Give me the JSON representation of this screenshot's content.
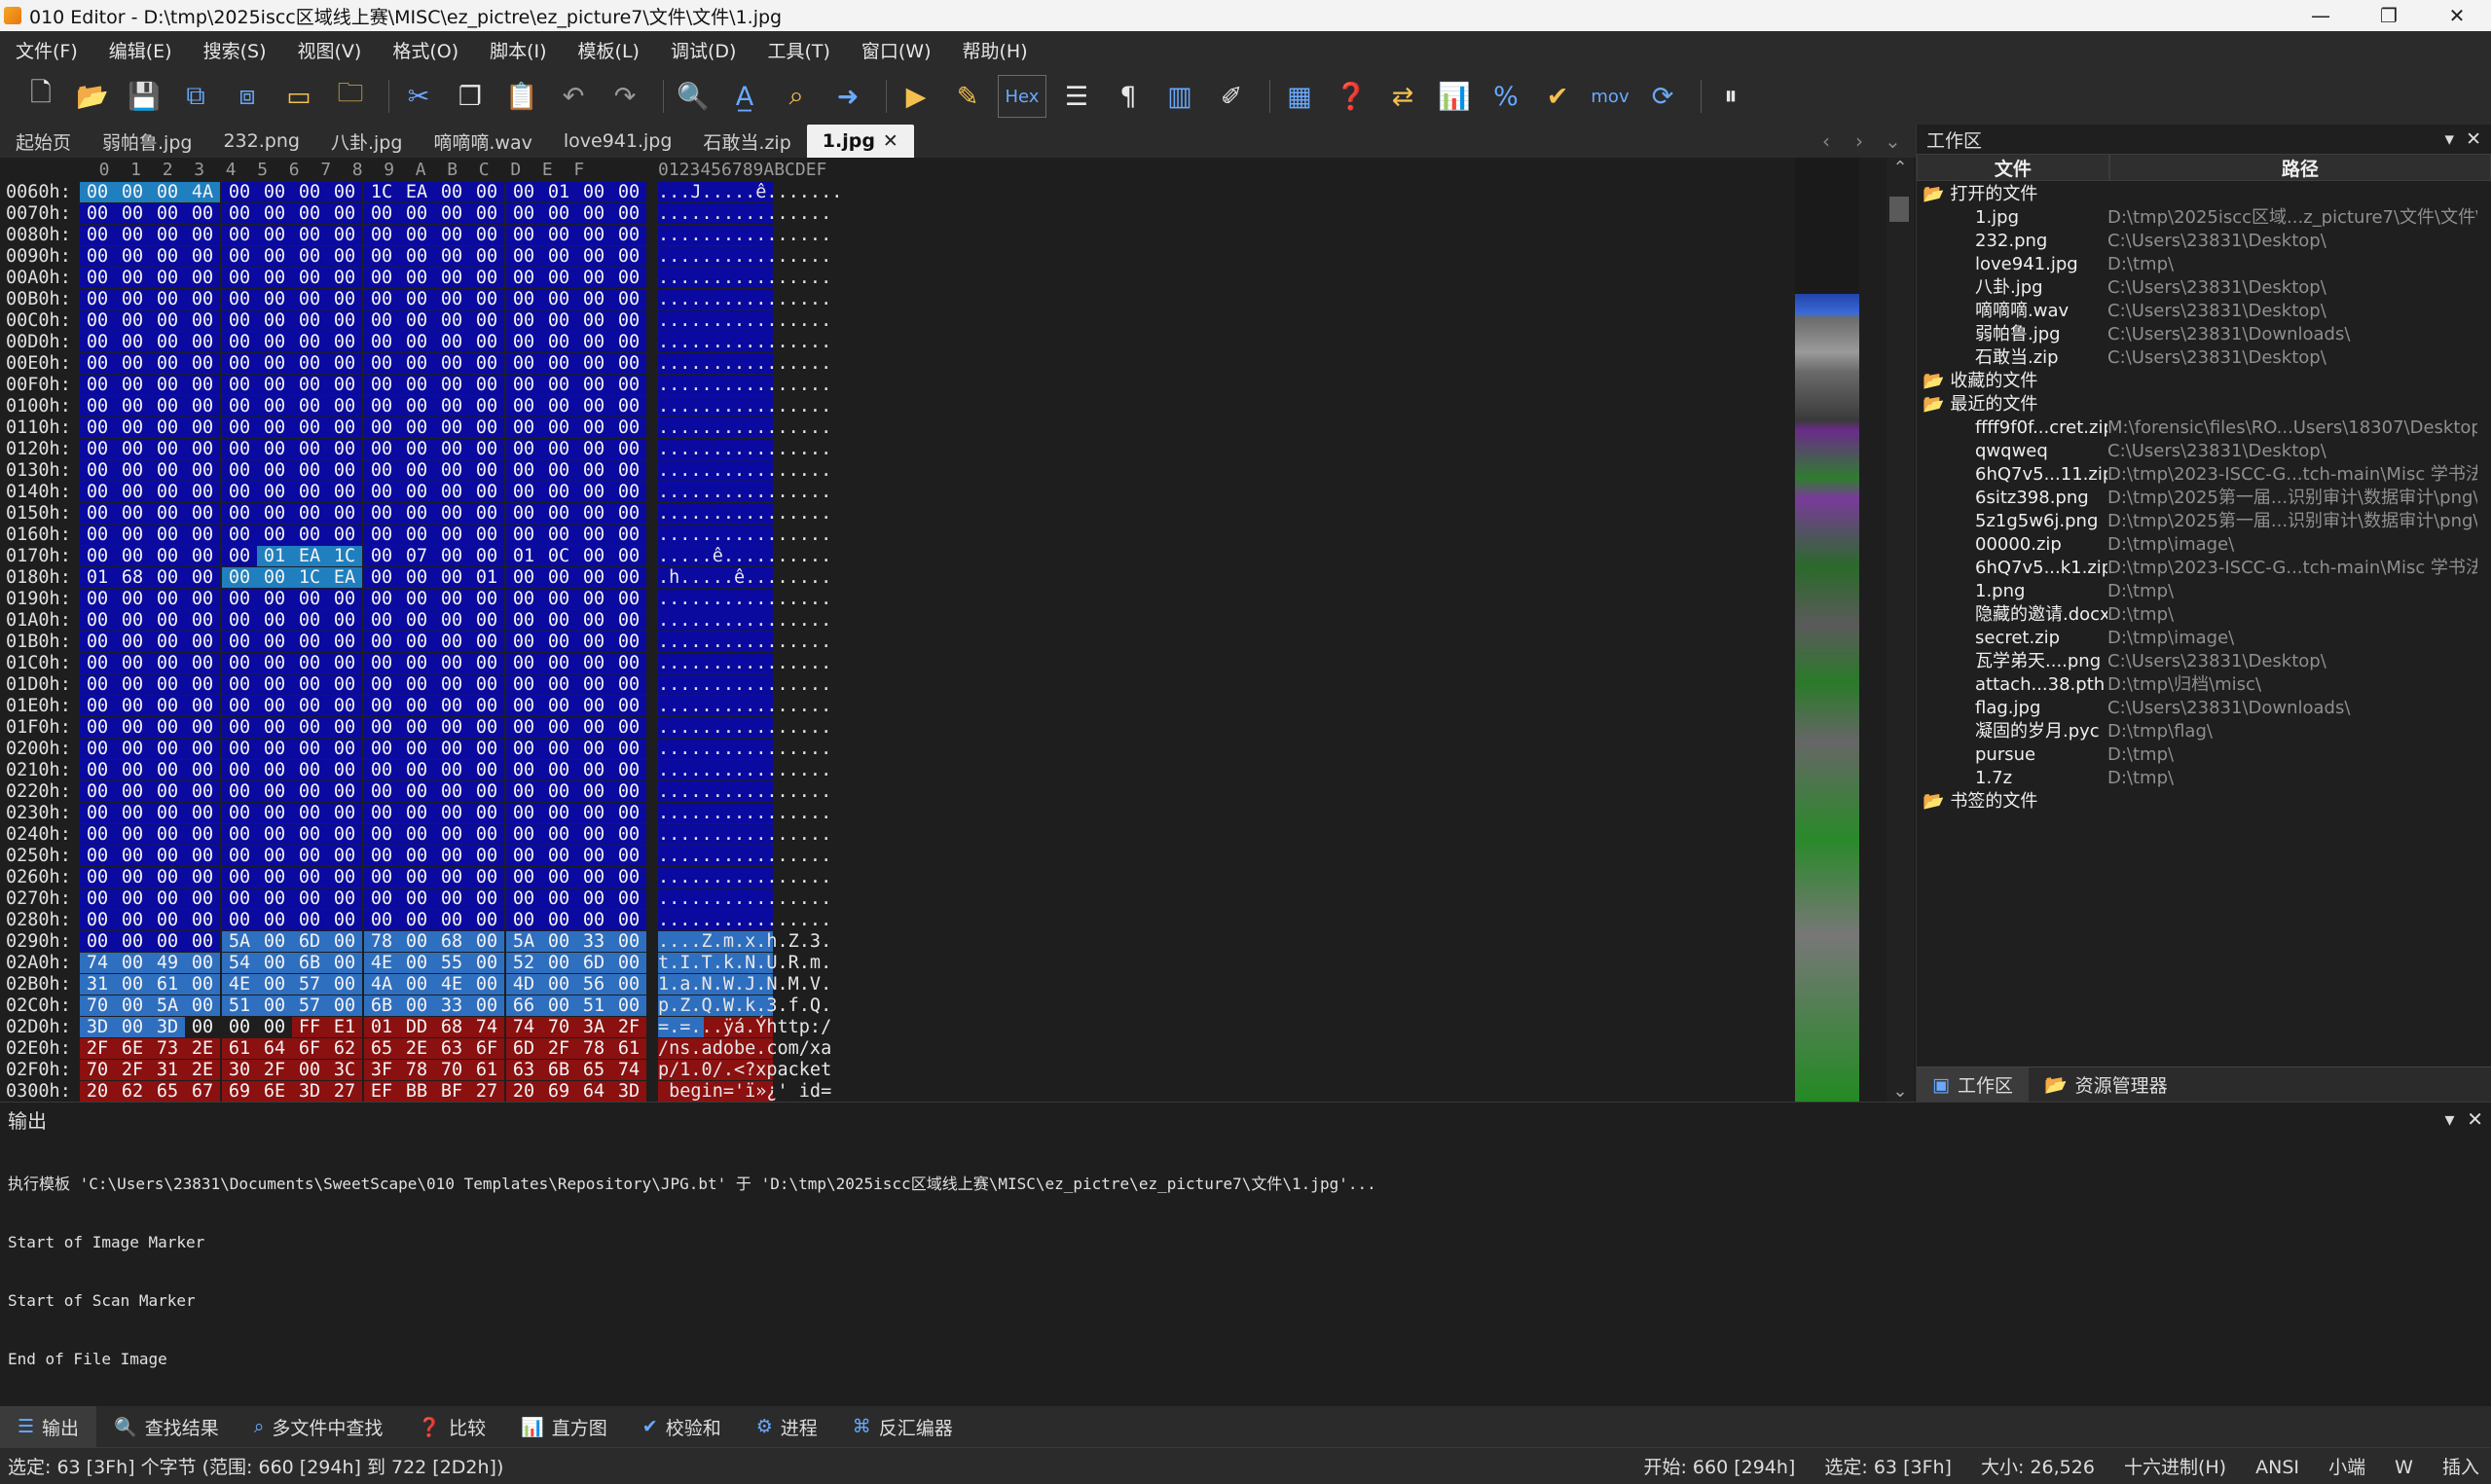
{
  "window": {
    "title": "010 Editor - D:\\tmp\\2025iscc区域线上赛\\MISC\\ez_pictre\\ez_picture7\\文件\\文件\\1.jpg",
    "min": "—",
    "max": "❐",
    "close": "✕"
  },
  "menu": [
    "文件(F)",
    "编辑(E)",
    "搜索(S)",
    "视图(V)",
    "格式(O)",
    "脚本(I)",
    "模板(L)",
    "调试(D)",
    "工具(T)",
    "窗口(W)",
    "帮助(H)"
  ],
  "toolbar": {
    "hex_label": "Hex",
    "mov_label": "mov"
  },
  "tabs": [
    "起始页",
    "弱帕鲁.jpg",
    "232.png",
    "八卦.jpg",
    "嘀嘀嘀.wav",
    "love941.jpg",
    "石敢当.zip",
    "1.jpg"
  ],
  "hex": {
    "column_header": "  0  1  2  3  4  5  6  7  8  9  A  B  C  D  E  F",
    "ascii_header": "0123456789ABCDEF",
    "rows": [
      {
        "off": "0060h:",
        "b": [
          "00",
          "00",
          "00",
          "4A",
          "00",
          "00",
          "00",
          "00",
          "1C",
          "EA",
          "00",
          "00",
          "00",
          "01",
          "00",
          "00"
        ],
        "a": "...J.....ê......."
      },
      {
        "off": "0070h:",
        "b": [
          "00",
          "00",
          "00",
          "00",
          "00",
          "00",
          "00",
          "00",
          "00",
          "00",
          "00",
          "00",
          "00",
          "00",
          "00",
          "00"
        ],
        "a": "................"
      },
      {
        "off": "0080h:",
        "b": [
          "00",
          "00",
          "00",
          "00",
          "00",
          "00",
          "00",
          "00",
          "00",
          "00",
          "00",
          "00",
          "00",
          "00",
          "00",
          "00"
        ],
        "a": "................"
      },
      {
        "off": "0090h:",
        "b": [
          "00",
          "00",
          "00",
          "00",
          "00",
          "00",
          "00",
          "00",
          "00",
          "00",
          "00",
          "00",
          "00",
          "00",
          "00",
          "00"
        ],
        "a": "................"
      },
      {
        "off": "00A0h:",
        "b": [
          "00",
          "00",
          "00",
          "00",
          "00",
          "00",
          "00",
          "00",
          "00",
          "00",
          "00",
          "00",
          "00",
          "00",
          "00",
          "00"
        ],
        "a": "................"
      },
      {
        "off": "00B0h:",
        "b": [
          "00",
          "00",
          "00",
          "00",
          "00",
          "00",
          "00",
          "00",
          "00",
          "00",
          "00",
          "00",
          "00",
          "00",
          "00",
          "00"
        ],
        "a": "................"
      },
      {
        "off": "00C0h:",
        "b": [
          "00",
          "00",
          "00",
          "00",
          "00",
          "00",
          "00",
          "00",
          "00",
          "00",
          "00",
          "00",
          "00",
          "00",
          "00",
          "00"
        ],
        "a": "................"
      },
      {
        "off": "00D0h:",
        "b": [
          "00",
          "00",
          "00",
          "00",
          "00",
          "00",
          "00",
          "00",
          "00",
          "00",
          "00",
          "00",
          "00",
          "00",
          "00",
          "00"
        ],
        "a": "................"
      },
      {
        "off": "00E0h:",
        "b": [
          "00",
          "00",
          "00",
          "00",
          "00",
          "00",
          "00",
          "00",
          "00",
          "00",
          "00",
          "00",
          "00",
          "00",
          "00",
          "00"
        ],
        "a": "................"
      },
      {
        "off": "00F0h:",
        "b": [
          "00",
          "00",
          "00",
          "00",
          "00",
          "00",
          "00",
          "00",
          "00",
          "00",
          "00",
          "00",
          "00",
          "00",
          "00",
          "00"
        ],
        "a": "................"
      },
      {
        "off": "0100h:",
        "b": [
          "00",
          "00",
          "00",
          "00",
          "00",
          "00",
          "00",
          "00",
          "00",
          "00",
          "00",
          "00",
          "00",
          "00",
          "00",
          "00"
        ],
        "a": "................"
      },
      {
        "off": "0110h:",
        "b": [
          "00",
          "00",
          "00",
          "00",
          "00",
          "00",
          "00",
          "00",
          "00",
          "00",
          "00",
          "00",
          "00",
          "00",
          "00",
          "00"
        ],
        "a": "................"
      },
      {
        "off": "0120h:",
        "b": [
          "00",
          "00",
          "00",
          "00",
          "00",
          "00",
          "00",
          "00",
          "00",
          "00",
          "00",
          "00",
          "00",
          "00",
          "00",
          "00"
        ],
        "a": "................"
      },
      {
        "off": "0130h:",
        "b": [
          "00",
          "00",
          "00",
          "00",
          "00",
          "00",
          "00",
          "00",
          "00",
          "00",
          "00",
          "00",
          "00",
          "00",
          "00",
          "00"
        ],
        "a": "................"
      },
      {
        "off": "0140h:",
        "b": [
          "00",
          "00",
          "00",
          "00",
          "00",
          "00",
          "00",
          "00",
          "00",
          "00",
          "00",
          "00",
          "00",
          "00",
          "00",
          "00"
        ],
        "a": "................"
      },
      {
        "off": "0150h:",
        "b": [
          "00",
          "00",
          "00",
          "00",
          "00",
          "00",
          "00",
          "00",
          "00",
          "00",
          "00",
          "00",
          "00",
          "00",
          "00",
          "00"
        ],
        "a": "................"
      },
      {
        "off": "0160h:",
        "b": [
          "00",
          "00",
          "00",
          "00",
          "00",
          "00",
          "00",
          "00",
          "00",
          "00",
          "00",
          "00",
          "00",
          "00",
          "00",
          "00"
        ],
        "a": "................"
      },
      {
        "off": "0170h:",
        "b": [
          "00",
          "00",
          "00",
          "00",
          "00",
          "01",
          "EA",
          "1C",
          "00",
          "07",
          "00",
          "00",
          "01",
          "0C",
          "00",
          "00"
        ],
        "a": ".....ê.........."
      },
      {
        "off": "0180h:",
        "b": [
          "01",
          "68",
          "00",
          "00",
          "00",
          "00",
          "1C",
          "EA",
          "00",
          "00",
          "00",
          "01",
          "00",
          "00",
          "00",
          "00"
        ],
        "a": ".h.....ê........"
      },
      {
        "off": "0190h:",
        "b": [
          "00",
          "00",
          "00",
          "00",
          "00",
          "00",
          "00",
          "00",
          "00",
          "00",
          "00",
          "00",
          "00",
          "00",
          "00",
          "00"
        ],
        "a": "................"
      },
      {
        "off": "01A0h:",
        "b": [
          "00",
          "00",
          "00",
          "00",
          "00",
          "00",
          "00",
          "00",
          "00",
          "00",
          "00",
          "00",
          "00",
          "00",
          "00",
          "00"
        ],
        "a": "................"
      },
      {
        "off": "01B0h:",
        "b": [
          "00",
          "00",
          "00",
          "00",
          "00",
          "00",
          "00",
          "00",
          "00",
          "00",
          "00",
          "00",
          "00",
          "00",
          "00",
          "00"
        ],
        "a": "................"
      },
      {
        "off": "01C0h:",
        "b": [
          "00",
          "00",
          "00",
          "00",
          "00",
          "00",
          "00",
          "00",
          "00",
          "00",
          "00",
          "00",
          "00",
          "00",
          "00",
          "00"
        ],
        "a": "................"
      },
      {
        "off": "01D0h:",
        "b": [
          "00",
          "00",
          "00",
          "00",
          "00",
          "00",
          "00",
          "00",
          "00",
          "00",
          "00",
          "00",
          "00",
          "00",
          "00",
          "00"
        ],
        "a": "................"
      },
      {
        "off": "01E0h:",
        "b": [
          "00",
          "00",
          "00",
          "00",
          "00",
          "00",
          "00",
          "00",
          "00",
          "00",
          "00",
          "00",
          "00",
          "00",
          "00",
          "00"
        ],
        "a": "................"
      },
      {
        "off": "01F0h:",
        "b": [
          "00",
          "00",
          "00",
          "00",
          "00",
          "00",
          "00",
          "00",
          "00",
          "00",
          "00",
          "00",
          "00",
          "00",
          "00",
          "00"
        ],
        "a": "................"
      },
      {
        "off": "0200h:",
        "b": [
          "00",
          "00",
          "00",
          "00",
          "00",
          "00",
          "00",
          "00",
          "00",
          "00",
          "00",
          "00",
          "00",
          "00",
          "00",
          "00"
        ],
        "a": "................"
      },
      {
        "off": "0210h:",
        "b": [
          "00",
          "00",
          "00",
          "00",
          "00",
          "00",
          "00",
          "00",
          "00",
          "00",
          "00",
          "00",
          "00",
          "00",
          "00",
          "00"
        ],
        "a": "................"
      },
      {
        "off": "0220h:",
        "b": [
          "00",
          "00",
          "00",
          "00",
          "00",
          "00",
          "00",
          "00",
          "00",
          "00",
          "00",
          "00",
          "00",
          "00",
          "00",
          "00"
        ],
        "a": "................"
      },
      {
        "off": "0230h:",
        "b": [
          "00",
          "00",
          "00",
          "00",
          "00",
          "00",
          "00",
          "00",
          "00",
          "00",
          "00",
          "00",
          "00",
          "00",
          "00",
          "00"
        ],
        "a": "................"
      },
      {
        "off": "0240h:",
        "b": [
          "00",
          "00",
          "00",
          "00",
          "00",
          "00",
          "00",
          "00",
          "00",
          "00",
          "00",
          "00",
          "00",
          "00",
          "00",
          "00"
        ],
        "a": "................"
      },
      {
        "off": "0250h:",
        "b": [
          "00",
          "00",
          "00",
          "00",
          "00",
          "00",
          "00",
          "00",
          "00",
          "00",
          "00",
          "00",
          "00",
          "00",
          "00",
          "00"
        ],
        "a": "................"
      },
      {
        "off": "0260h:",
        "b": [
          "00",
          "00",
          "00",
          "00",
          "00",
          "00",
          "00",
          "00",
          "00",
          "00",
          "00",
          "00",
          "00",
          "00",
          "00",
          "00"
        ],
        "a": "................"
      },
      {
        "off": "0270h:",
        "b": [
          "00",
          "00",
          "00",
          "00",
          "00",
          "00",
          "00",
          "00",
          "00",
          "00",
          "00",
          "00",
          "00",
          "00",
          "00",
          "00"
        ],
        "a": "................"
      },
      {
        "off": "0280h:",
        "b": [
          "00",
          "00",
          "00",
          "00",
          "00",
          "00",
          "00",
          "00",
          "00",
          "00",
          "00",
          "00",
          "00",
          "00",
          "00",
          "00"
        ],
        "a": "................"
      },
      {
        "off": "0290h:",
        "b": [
          "00",
          "00",
          "00",
          "00",
          "5A",
          "00",
          "6D",
          "00",
          "78",
          "00",
          "68",
          "00",
          "5A",
          "00",
          "33",
          "00"
        ],
        "a": "....Z.m.x.h.Z.3."
      },
      {
        "off": "02A0h:",
        "b": [
          "74",
          "00",
          "49",
          "00",
          "54",
          "00",
          "6B",
          "00",
          "4E",
          "00",
          "55",
          "00",
          "52",
          "00",
          "6D",
          "00"
        ],
        "a": "t.I.T.k.N.U.R.m."
      },
      {
        "off": "02B0h:",
        "b": [
          "31",
          "00",
          "61",
          "00",
          "4E",
          "00",
          "57",
          "00",
          "4A",
          "00",
          "4E",
          "00",
          "4D",
          "00",
          "56",
          "00"
        ],
        "a": "1.a.N.W.J.N.M.V."
      },
      {
        "off": "02C0h:",
        "b": [
          "70",
          "00",
          "5A",
          "00",
          "51",
          "00",
          "57",
          "00",
          "6B",
          "00",
          "33",
          "00",
          "66",
          "00",
          "51",
          "00"
        ],
        "a": "p.Z.Q.W.k.3.f.Q."
      },
      {
        "off": "02D0h:",
        "b": [
          "3D",
          "00",
          "3D",
          "00",
          "00",
          "00",
          "FF",
          "E1",
          "01",
          "DD",
          "68",
          "74",
          "74",
          "70",
          "3A",
          "2F"
        ],
        "a": "=.=...ÿá.Ýhttp:/"
      },
      {
        "off": "02E0h:",
        "b": [
          "2F",
          "6E",
          "73",
          "2E",
          "61",
          "64",
          "6F",
          "62",
          "65",
          "2E",
          "63",
          "6F",
          "6D",
          "2F",
          "78",
          "61"
        ],
        "a": "/ns.adobe.com/xa"
      },
      {
        "off": "02F0h:",
        "b": [
          "70",
          "2F",
          "31",
          "2E",
          "30",
          "2F",
          "00",
          "3C",
          "3F",
          "78",
          "70",
          "61",
          "63",
          "6B",
          "65",
          "74"
        ],
        "a": "p/1.0/.<?xpacket"
      },
      {
        "off": "0300h:",
        "b": [
          "20",
          "62",
          "65",
          "67",
          "69",
          "6E",
          "3D",
          "27",
          "EF",
          "BB",
          "BF",
          "27",
          "20",
          "69",
          "64",
          "3D"
        ],
        "a": " begin='ï»¿' id="
      }
    ]
  },
  "colors": {
    "blue_bg": "#0a0aa0",
    "teal_bg": "#1f7fbf",
    "sel_bg": "#2f6fc0",
    "red_bg": "#8b1010",
    "dark_bg": "#1e1e1e"
  },
  "workspace": {
    "title": "工作区",
    "col_file": "文件",
    "col_path": "路径",
    "open_group": "打开的文件",
    "open": [
      [
        "1.jpg",
        "D:\\tmp\\2025iscc区域...z_picture7\\文件\\文件\\"
      ],
      [
        "232.png",
        "C:\\Users\\23831\\Desktop\\"
      ],
      [
        "love941.jpg",
        "D:\\tmp\\"
      ],
      [
        "八卦.jpg",
        "C:\\Users\\23831\\Desktop\\"
      ],
      [
        "嘀嘀嘀.wav",
        "C:\\Users\\23831\\Desktop\\"
      ],
      [
        "弱帕鲁.jpg",
        "C:\\Users\\23831\\Downloads\\"
      ],
      [
        "石敢当.zip",
        "C:\\Users\\23831\\Desktop\\"
      ]
    ],
    "fav_group": "收藏的文件",
    "recent_group": "最近的文件",
    "recent": [
      [
        "ffff9f0f...cret.zip",
        "M:\\forensic\\files\\RO...Users\\18307\\Desktop\\"
      ],
      [
        "qwqweq",
        "C:\\Users\\23831\\Desktop\\"
      ],
      [
        "6hQ7v5...11.zip",
        "D:\\tmp\\2023-ISCC-G...tch-main\\Misc 学书法\\"
      ],
      [
        "6sitz398.png",
        "D:\\tmp\\2025第一届...识别审计\\数据审计\\png\\"
      ],
      [
        "5z1g5w6j.png",
        "D:\\tmp\\2025第一届...识别审计\\数据审计\\png\\"
      ],
      [
        "00000.zip",
        "D:\\tmp\\image\\"
      ],
      [
        "6hQ7v5...k1.zip",
        "D:\\tmp\\2023-ISCC-G...tch-main\\Misc 学书法\\"
      ],
      [
        "1.png",
        "D:\\tmp\\"
      ],
      [
        "隐藏的邀请.docx",
        "D:\\tmp\\"
      ],
      [
        "secret.zip",
        "D:\\tmp\\image\\"
      ],
      [
        "瓦学弟天....png",
        "C:\\Users\\23831\\Desktop\\"
      ],
      [
        "attach...38.pth",
        "D:\\tmp\\归档\\misc\\"
      ],
      [
        "flag.jpg",
        "C:\\Users\\23831\\Downloads\\"
      ],
      [
        "凝固的岁月.pyc",
        "D:\\tmp\\flag\\"
      ],
      [
        "pursue",
        "D:\\tmp\\"
      ],
      [
        "1.7z",
        "D:\\tmp\\"
      ]
    ],
    "bookmark_group": "书签的文件",
    "tab_workspace": "工作区",
    "tab_explorer": "资源管理器"
  },
  "output": {
    "title": "输出",
    "lines": [
      "执行模板 'C:\\Users\\23831\\Documents\\SweetScape\\010 Templates\\Repository\\JPG.bt' 于 'D:\\tmp\\2025iscc区域线上赛\\MISC\\ez_pictre\\ez_picture7\\文件\\1.jpg'...",
      "Start of Image Marker",
      "Start of Scan Marker",
      "End of File Image"
    ]
  },
  "bottom_tabs": [
    "输出",
    "查找结果",
    "多文件中查找",
    "比较",
    "直方图",
    "校验和",
    "进程",
    "反汇编器"
  ],
  "status": {
    "left": "选定: 63 [3Fh] 个字节 (范围: 660 [294h] 到 722 [2D2h])",
    "start": "开始: 660 [294h]",
    "sel": "选定: 63 [3Fh]",
    "size": "大小: 26,526",
    "mode": "十六进制(H)",
    "enc": "ANSI",
    "endian": "小端",
    "w": "W",
    "ins": "插入"
  }
}
